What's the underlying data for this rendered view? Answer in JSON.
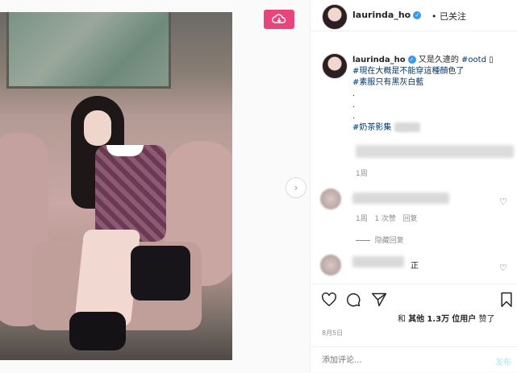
{
  "header": {
    "username": "laurinda_ho",
    "follow_status": "• 已关注"
  },
  "caption": {
    "username": "laurinda_ho",
    "line1_text": "又是久違的",
    "line1_tag": "#ootd",
    "line2": "#現在大概是不能穿這種顏色了",
    "line3": "#素服只有黑灰白藍",
    "dot1": ".",
    "dot2": ".",
    "dot3": ".",
    "line4_tag": "#奶茶影集",
    "time": "1周"
  },
  "comment1": {
    "time": "1周",
    "likes": "1 次赞",
    "reply": "回复",
    "hide_replies": "隐藏回复"
  },
  "comment2": {
    "suffix": "正"
  },
  "likes_line": {
    "prefix": "和",
    "others": "其他",
    "count": "1.3万",
    "users": "位用户",
    "suffix": "赞了"
  },
  "post_date": "8月5日",
  "comment_input": {
    "placeholder": "添加评论..."
  },
  "post_button": "发布",
  "colors": {
    "download_button": "#e8457d",
    "hashtag": "#00376b",
    "verified": "#3897f0"
  },
  "icons": {
    "download": "cloud-download-icon",
    "next": "chevron-right-icon",
    "heart": "heart-icon",
    "comment": "comment-icon",
    "share": "paper-plane-icon",
    "save": "bookmark-icon"
  }
}
